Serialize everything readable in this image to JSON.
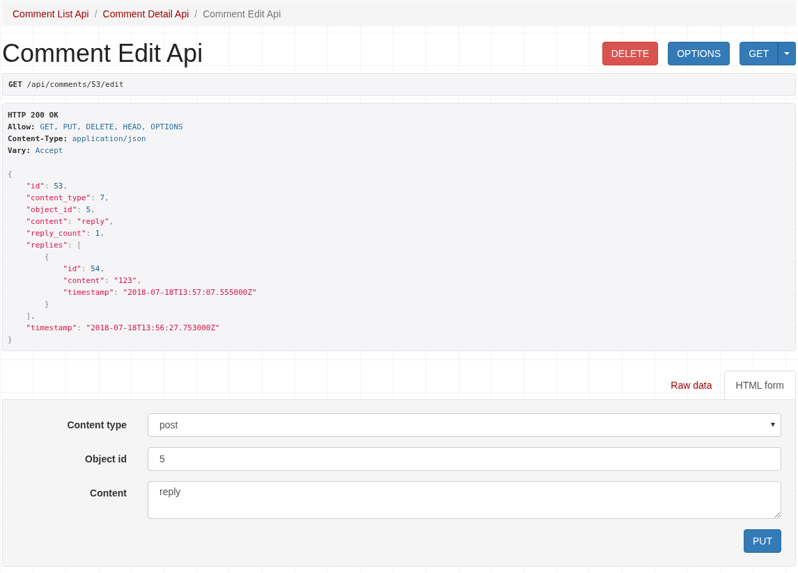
{
  "breadcrumbs": [
    {
      "label": "Comment List Api",
      "selected": false
    },
    {
      "label": "Comment Detail Api",
      "selected": false
    },
    {
      "label": "Comment Edit Api",
      "selected": true
    }
  ],
  "separator": "/",
  "title": "Comment Edit Api",
  "actions": [
    {
      "label": "DELETE",
      "kind": "danger"
    },
    {
      "label": "OPTIONS",
      "kind": "primary"
    },
    {
      "label": "GET",
      "kind": "split"
    }
  ],
  "request": {
    "method": "GET",
    "path": "/api/comments/53/edit"
  },
  "response": {
    "status": "HTTP 200 OK",
    "headers": [
      {
        "name": "Allow:",
        "value": "GET, PUT, DELETE, HEAD, OPTIONS"
      },
      {
        "name": "Content-Type:",
        "value": "application/json"
      },
      {
        "name": "Vary:",
        "value": "Accept"
      }
    ],
    "body": [
      [
        {
          "kind": "punct",
          "text": "{"
        }
      ],
      [
        {
          "kind": "key",
          "text": "    \"id\""
        },
        {
          "kind": "punct",
          "text": ": "
        },
        {
          "kind": "number",
          "text": "53"
        },
        {
          "kind": "punct",
          "text": ","
        }
      ],
      [
        {
          "kind": "key",
          "text": "    \"content_type\""
        },
        {
          "kind": "punct",
          "text": ": "
        },
        {
          "kind": "number",
          "text": "7"
        },
        {
          "kind": "punct",
          "text": ","
        }
      ],
      [
        {
          "kind": "key",
          "text": "    \"object_id\""
        },
        {
          "kind": "punct",
          "text": ": "
        },
        {
          "kind": "number",
          "text": "5"
        },
        {
          "kind": "punct",
          "text": ","
        }
      ],
      [
        {
          "kind": "key",
          "text": "    \"content\""
        },
        {
          "kind": "punct",
          "text": ": "
        },
        {
          "kind": "string",
          "text": "\"reply\""
        },
        {
          "kind": "punct",
          "text": ","
        }
      ],
      [
        {
          "kind": "key",
          "text": "    \"reply_count\""
        },
        {
          "kind": "punct",
          "text": ": "
        },
        {
          "kind": "number",
          "text": "1"
        },
        {
          "kind": "punct",
          "text": ","
        }
      ],
      [
        {
          "kind": "key",
          "text": "    \"replies\""
        },
        {
          "kind": "punct",
          "text": ": ["
        }
      ],
      [
        {
          "kind": "punct",
          "text": "        {"
        }
      ],
      [
        {
          "kind": "key",
          "text": "            \"id\""
        },
        {
          "kind": "punct",
          "text": ": "
        },
        {
          "kind": "number",
          "text": "54"
        },
        {
          "kind": "punct",
          "text": ","
        }
      ],
      [
        {
          "kind": "key",
          "text": "            \"content\""
        },
        {
          "kind": "punct",
          "text": ": "
        },
        {
          "kind": "string",
          "text": "\"123\""
        },
        {
          "kind": "punct",
          "text": ","
        }
      ],
      [
        {
          "kind": "key",
          "text": "            \"timestamp\""
        },
        {
          "kind": "punct",
          "text": ": "
        },
        {
          "kind": "string",
          "text": "\"2018-07-18T13:57:07.555000Z\""
        }
      ],
      [
        {
          "kind": "punct",
          "text": "        }"
        }
      ],
      [
        {
          "kind": "punct",
          "text": "    ],"
        }
      ],
      [
        {
          "kind": "key",
          "text": "    \"timestamp\""
        },
        {
          "kind": "punct",
          "text": ": "
        },
        {
          "kind": "string",
          "text": "\"2018-07-18T13:56:27.753000Z\""
        }
      ],
      [
        {
          "kind": "punct",
          "text": "}"
        }
      ]
    ]
  },
  "tabs": [
    {
      "label": "Raw data",
      "selected": false
    },
    {
      "label": "HTML form",
      "selected": true
    }
  ],
  "form": {
    "fields": [
      {
        "label": "Content type",
        "kind": "select",
        "value": "post"
      },
      {
        "label": "Object id",
        "kind": "input",
        "value": "5"
      },
      {
        "label": "Content",
        "kind": "textarea",
        "value": "reply"
      }
    ],
    "submit": "PUT"
  }
}
